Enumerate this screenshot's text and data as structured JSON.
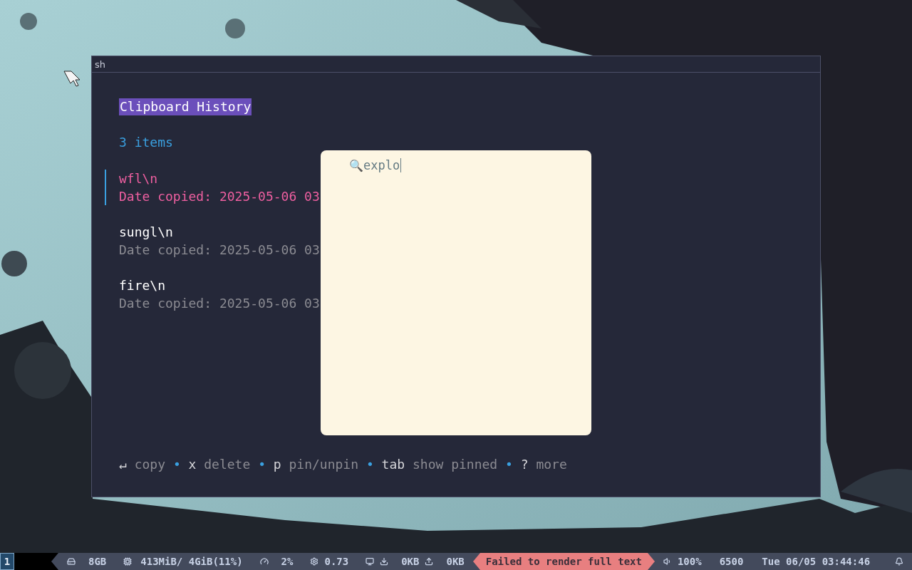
{
  "window": {
    "title": "sh"
  },
  "heading": "Clipboard History",
  "count": "3 items",
  "items": [
    {
      "text": "wfl\\n",
      "date": "Date copied: 2025-05-06 03",
      "selected": true
    },
    {
      "text": "sungl\\n",
      "date": "Date copied: 2025-05-06 03",
      "selected": false
    },
    {
      "text": "fire\\n",
      "date": "Date copied: 2025-05-06 03",
      "selected": false
    }
  ],
  "search": {
    "icon": "🔍",
    "value": "explo"
  },
  "hints": {
    "separator": "•",
    "items": [
      {
        "key": "↵",
        "label": "copy"
      },
      {
        "key": "x",
        "label": "delete"
      },
      {
        "key": "p",
        "label": "pin/unpin"
      },
      {
        "key": "tab",
        "label": "show pinned"
      },
      {
        "key": "?",
        "label": "more"
      }
    ]
  },
  "status_bar": {
    "workspace": {
      "label": "1",
      "selected": true
    },
    "modules": [
      {
        "kind": "disk",
        "text": "8GB"
      },
      {
        "kind": "memory",
        "text": "413MiB/ 4GiB(11%)"
      },
      {
        "kind": "cpu",
        "text": "2%"
      },
      {
        "kind": "load",
        "text": "0.73"
      },
      {
        "kind": "network",
        "down": "0KB",
        "up": "0KB"
      },
      {
        "kind": "error",
        "text": "Failed to render full text"
      },
      {
        "kind": "volume",
        "text": "100%"
      },
      {
        "kind": "plain",
        "text": "6500"
      },
      {
        "kind": "plain",
        "text": "Tue 06/05 03:44:46"
      },
      {
        "kind": "bell"
      }
    ]
  }
}
